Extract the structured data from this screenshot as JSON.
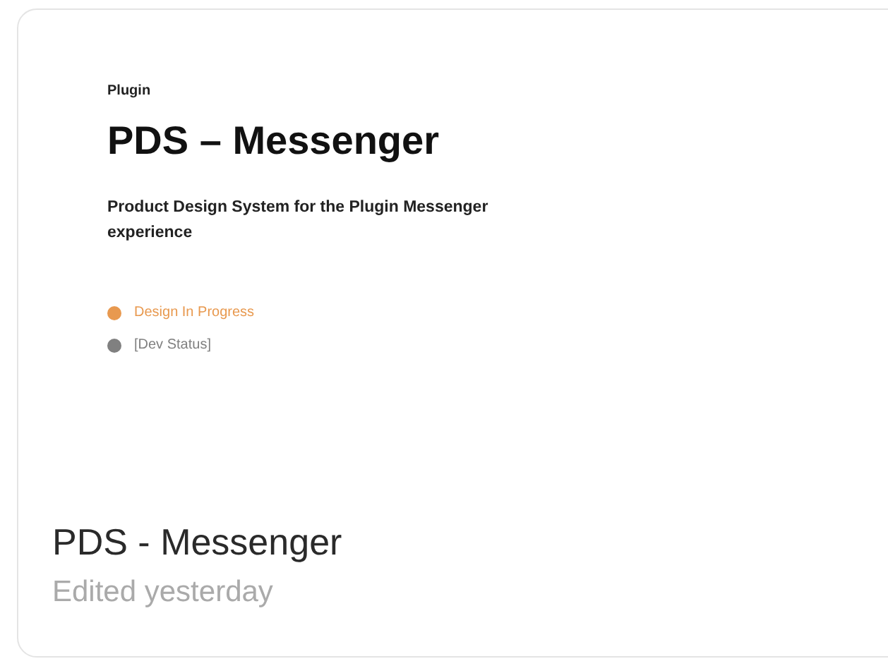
{
  "file_card": {
    "thumbnail": {
      "label": "Plugin",
      "title": "PDS – Messenger",
      "description": "Product Design System for the Plugin Messenger experience",
      "statuses": [
        {
          "label": "Design In Progress",
          "color": "#e8994f"
        },
        {
          "label": "[Dev Status]",
          "color": "#808080"
        }
      ]
    },
    "name": "PDS - Messenger",
    "edited": "Edited yesterday"
  }
}
